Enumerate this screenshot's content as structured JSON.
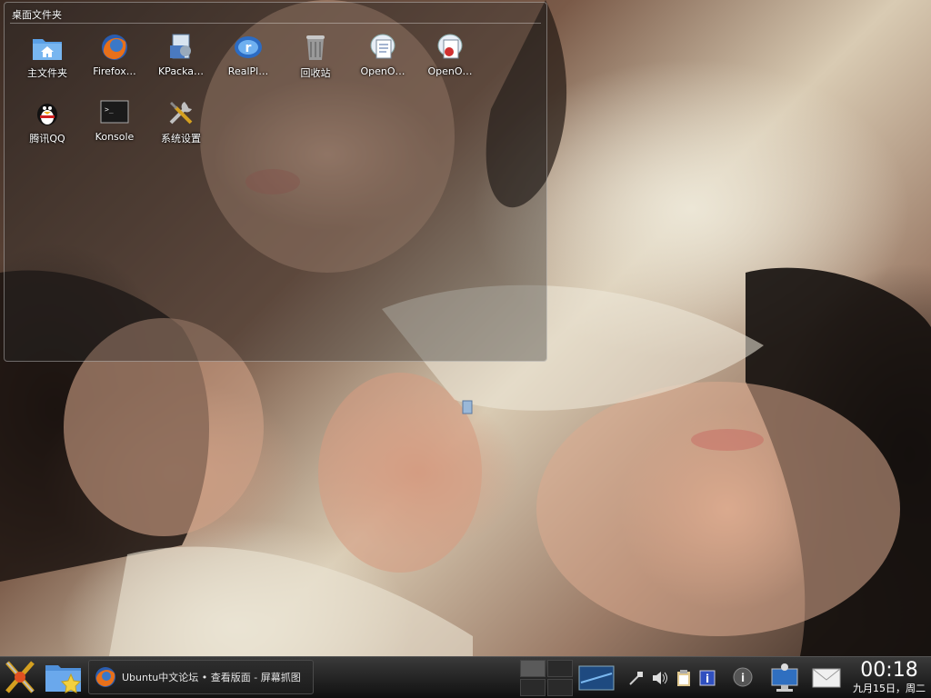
{
  "folderview": {
    "title": "桌面文件夹",
    "icons": [
      {
        "label": "主文件夹",
        "icon": "home-folder-icon"
      },
      {
        "label": "Firefox…",
        "icon": "firefox-icon"
      },
      {
        "label": "KPacka…",
        "icon": "kpackage-icon"
      },
      {
        "label": "RealPl…",
        "icon": "realplayer-icon"
      },
      {
        "label": "回收站",
        "icon": "trash-icon"
      },
      {
        "label": "OpenO…",
        "icon": "openoffice-writer-icon"
      },
      {
        "label": "OpenO…",
        "icon": "openoffice-impress-icon"
      },
      {
        "label": "腾讯QQ",
        "icon": "qq-penguin-icon"
      },
      {
        "label": "Konsole",
        "icon": "konsole-terminal-icon"
      },
      {
        "label": "系统设置",
        "icon": "system-settings-tools-icon"
      }
    ]
  },
  "taskbar": {
    "launcher_icon": "kde-launcher-icon",
    "folder_icon": "favorites-folder-icon",
    "task": {
      "label": "Ubuntu中文论坛 • 查看版面 - 屏幕抓图",
      "icon": "firefox-icon"
    },
    "pager": {
      "desktops": 4,
      "active": 1
    },
    "showdesktop_icon": "show-desktop-icon",
    "tray_icons": [
      "network-plug-icon",
      "volume-icon",
      "clipboard-icon",
      "notes-info-icon"
    ],
    "info_icon": "info-icon",
    "network_icon": "network-monitor-icon",
    "mail_icon": "mail-icon",
    "clock": {
      "time": "00:18",
      "date": "九月15日，周二"
    }
  },
  "colors": {
    "panel": "#1c1c1c",
    "accent": "#3a7fd0"
  }
}
